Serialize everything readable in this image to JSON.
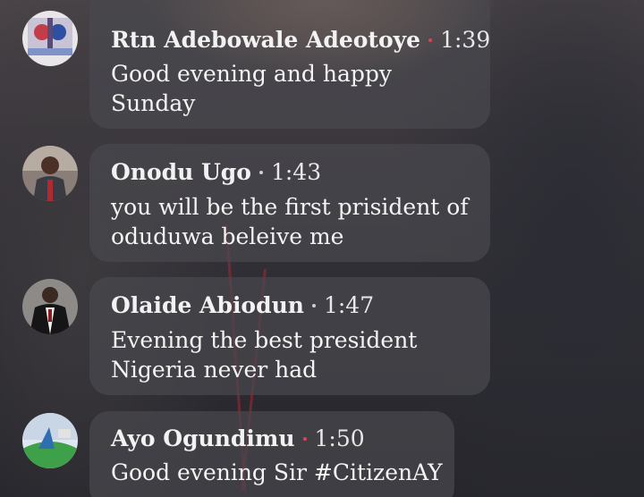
{
  "comments": [
    {
      "author": "Rtn Adebowale Adeotoye",
      "time": "1:39",
      "message": "Good evening and happy Sunday",
      "dot_color": "#e0405a",
      "avatar": "avatar-icon"
    },
    {
      "author": "Onodu Ugo",
      "time": "1:43",
      "message": "you will be the first prisident of oduduwa beleive me",
      "dot_color": "#cfcfcf",
      "avatar": "avatar-icon"
    },
    {
      "author": "Olaide Abiodun",
      "time": "1:47",
      "message": "Evening the best president Nigeria never had",
      "dot_color": "#cfcfcf",
      "avatar": "avatar-icon"
    },
    {
      "author": "Ayo Ogundimu",
      "time": "1:50",
      "message": "Good evening Sir #CitizenAY",
      "dot_color": "#e0405a",
      "avatar": "avatar-icon"
    }
  ]
}
